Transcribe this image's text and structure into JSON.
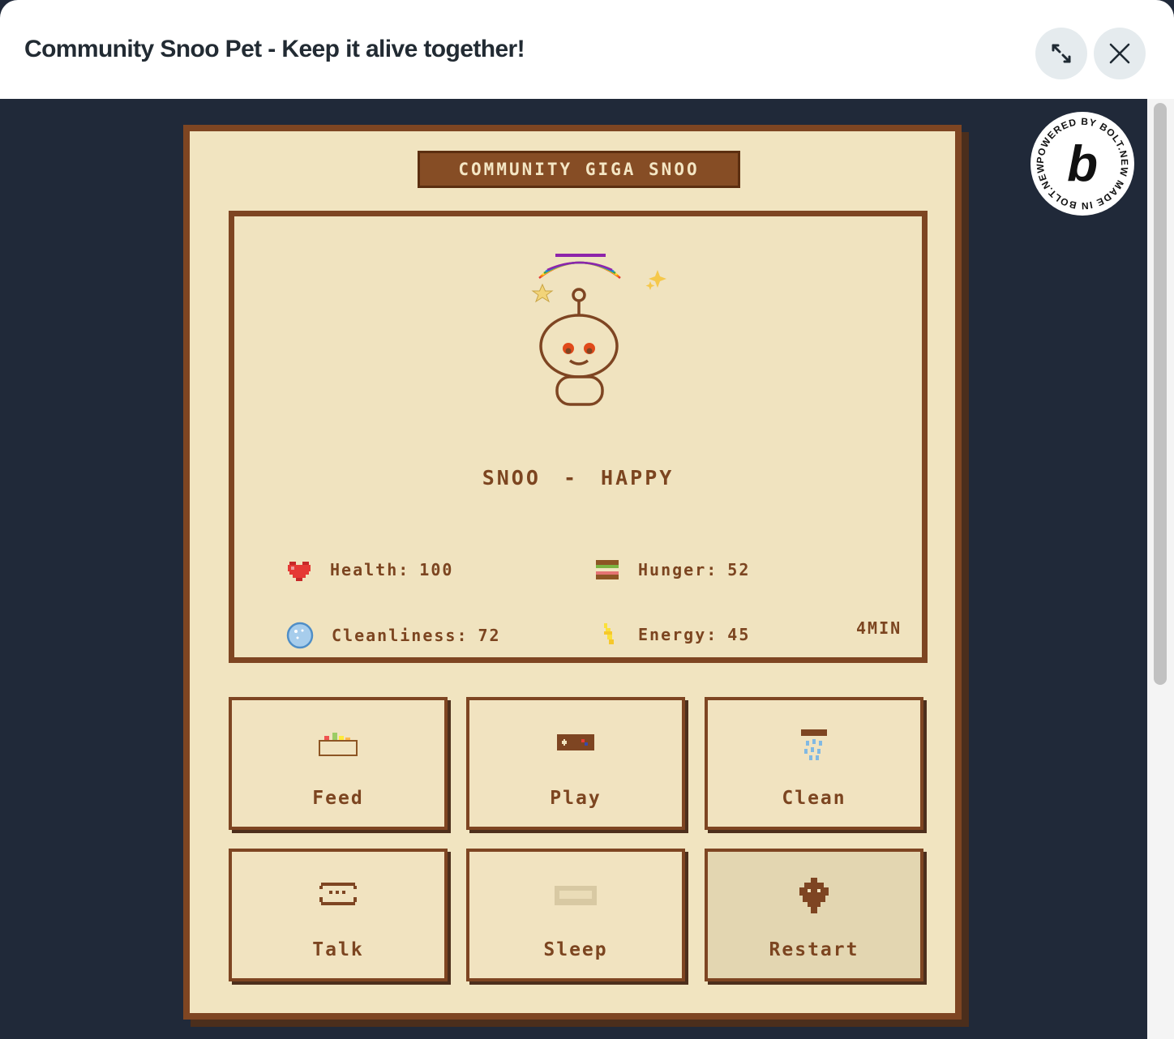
{
  "modal": {
    "title": "Community Snoo Pet - Keep it alive together!",
    "expand_icon": "expand-icon",
    "close_icon": "close-icon"
  },
  "badge": {
    "text": "POWERED BY BOLT.NEW MADE IN BOLT.NEW",
    "logo_letter": "b"
  },
  "game": {
    "title": "COMMUNITY GIGA SNOO",
    "pet_name": "SNOO",
    "pet_mood": "HAPPY",
    "pet_status": "SNOO - HAPPY",
    "stats": [
      {
        "label": "Health:",
        "value": "100",
        "icon": "heart-icon"
      },
      {
        "label": "Hunger:",
        "value": "52",
        "icon": "burger-icon"
      },
      {
        "label": "Cleanliness:",
        "value": "72",
        "icon": "bubble-icon"
      },
      {
        "label": "Energy:",
        "value": "45",
        "icon": "lightning-icon"
      }
    ],
    "timer": "4MIN",
    "actions": [
      {
        "label": "Feed",
        "icon": "food-bowl-icon"
      },
      {
        "label": "Play",
        "icon": "gamepad-icon"
      },
      {
        "label": "Clean",
        "icon": "shower-icon"
      },
      {
        "label": "Talk",
        "icon": "speech-icon"
      },
      {
        "label": "Sleep",
        "icon": "bed-icon"
      },
      {
        "label": "Restart",
        "icon": "restart-icon"
      }
    ]
  },
  "colors": {
    "frame": "#7e4522",
    "panel": "#f1e4c0",
    "text": "#7c4520",
    "background": "#202939"
  }
}
